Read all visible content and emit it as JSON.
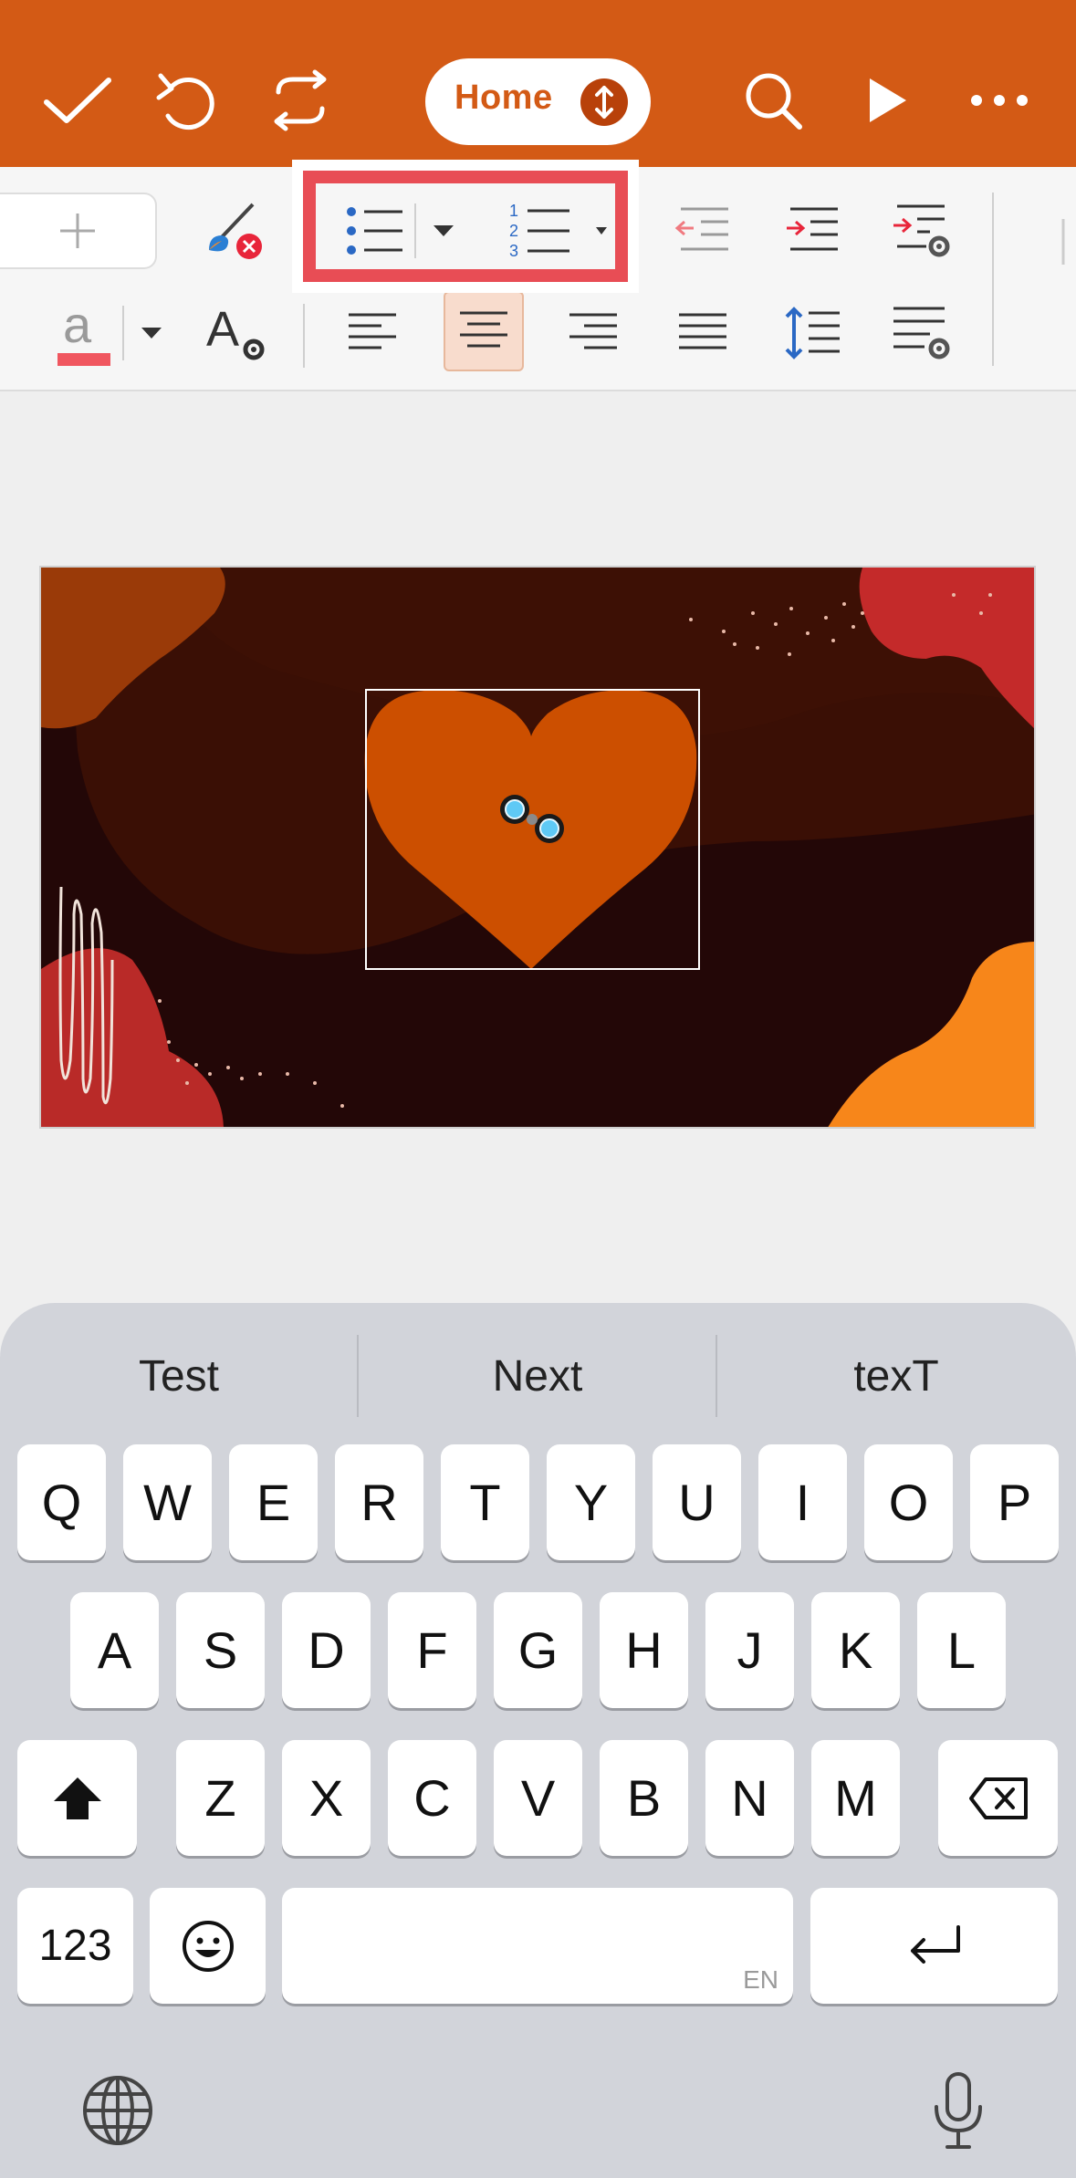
{
  "topbar": {
    "home_label": "Home",
    "icons": [
      "checkmark-icon",
      "undo-icon",
      "redo-icon",
      "search-icon",
      "play-icon",
      "more-icon"
    ]
  },
  "ribbon": {
    "icons": [
      "add-icon",
      "clear-formatting-icon",
      "bullet-list-icon",
      "bullet-list-dropdown-icon",
      "numbered-list-icon",
      "numbered-list-dropdown-icon",
      "decrease-indent-icon",
      "increase-indent-icon",
      "indent-settings-icon",
      "font-color-icon",
      "font-color-dropdown-icon",
      "text-effects-icon",
      "align-left-icon",
      "align-center-icon",
      "align-right-icon",
      "justify-icon",
      "line-spacing-icon",
      "paragraph-settings-icon"
    ],
    "font_color": "#f0565f",
    "accent": "#d35a15",
    "highlight_color": "#e84d55"
  },
  "keyboard": {
    "suggestions": [
      "Test",
      "Next",
      "texT"
    ],
    "row1": [
      "Q",
      "W",
      "E",
      "R",
      "T",
      "Y",
      "U",
      "I",
      "O",
      "P"
    ],
    "row2": [
      "A",
      "S",
      "D",
      "F",
      "G",
      "H",
      "J",
      "K",
      "L"
    ],
    "row3": [
      "Z",
      "X",
      "C",
      "V",
      "B",
      "N",
      "M"
    ],
    "numbers_key": "123",
    "space_hint": "EN"
  }
}
